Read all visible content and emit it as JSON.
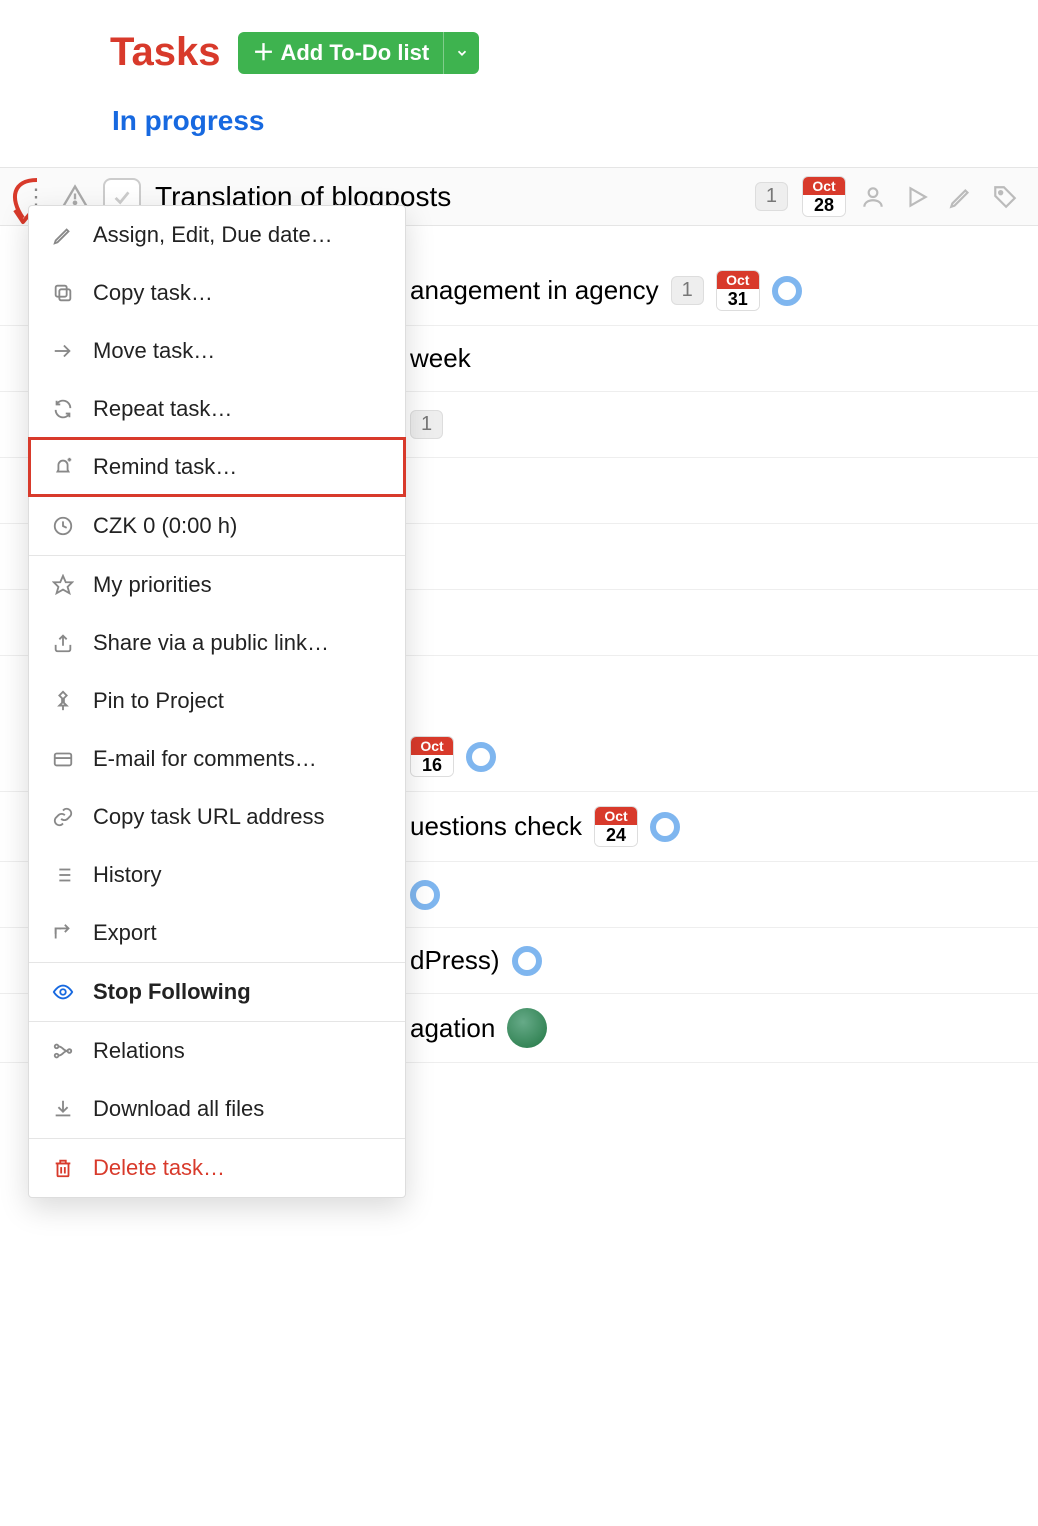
{
  "header": {
    "title": "Tasks",
    "add_button_label": "Add To-Do list",
    "section_label": "In progress"
  },
  "task": {
    "name": "Translation of blogposts",
    "count": "1",
    "date_month": "Oct",
    "date_day": "28"
  },
  "menu": {
    "assign_edit": "Assign, Edit, Due date…",
    "copy_task": "Copy task…",
    "move_task": "Move task…",
    "repeat_task": "Repeat task…",
    "remind_task": "Remind task…",
    "czk": "CZK 0 (0:00 h)",
    "my_priorities": "My priorities",
    "share_link": "Share via a public link…",
    "pin_project": "Pin to Project",
    "email_comments": "E-mail for comments…",
    "copy_url": "Copy task URL address",
    "history": "History",
    "export": "Export",
    "stop_following": "Stop Following",
    "relations": "Relations",
    "download_all": "Download all files",
    "delete_task": "Delete task…"
  },
  "bg_tasks": [
    {
      "text": "anagement in agency",
      "count": "1",
      "date_month": "Oct",
      "date_day": "31",
      "ring": true
    },
    {
      "text": "week"
    },
    {
      "count_only": "1"
    },
    {},
    {},
    {},
    {},
    {
      "date_month": "Oct",
      "date_day": "16",
      "ring": true
    },
    {
      "text": "uestions check",
      "date_month": "Oct",
      "date_day": "24",
      "ring": true
    },
    {
      "ring": true
    },
    {
      "text": "dPress)",
      "ring": true
    },
    {
      "text": "agation",
      "avatar": true
    }
  ]
}
